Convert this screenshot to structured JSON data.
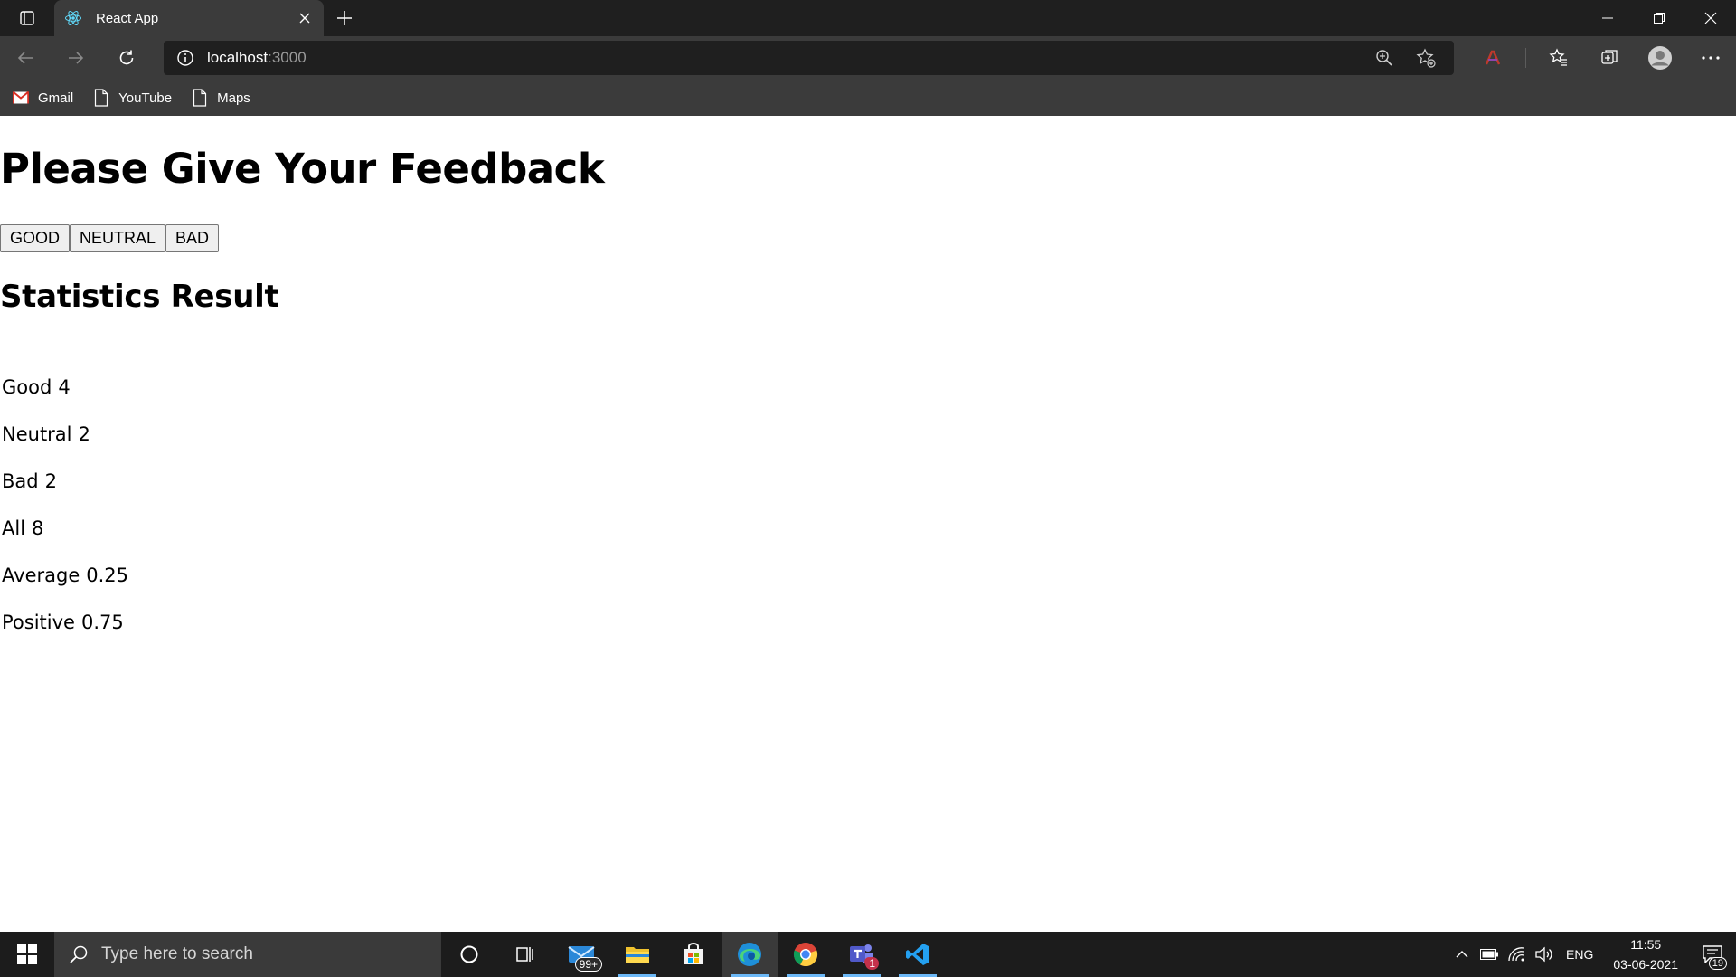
{
  "browser": {
    "tab_title": "React App",
    "url_host": "localhost",
    "url_port": ":3000",
    "bookmarks": [
      {
        "label": "Gmail",
        "icon": "gmail-icon"
      },
      {
        "label": "YouTube",
        "icon": "page-icon"
      },
      {
        "label": "Maps",
        "icon": "page-icon"
      }
    ]
  },
  "page": {
    "heading": "Please Give Your Feedback",
    "buttons": {
      "good": "GOOD",
      "neutral": "NEUTRAL",
      "bad": "BAD"
    },
    "stats_heading": "Statistics Result",
    "stats": [
      {
        "label": "Good",
        "value": "4"
      },
      {
        "label": "Neutral",
        "value": "2"
      },
      {
        "label": "Bad",
        "value": "2"
      },
      {
        "label": "All",
        "value": "8"
      },
      {
        "label": "Average",
        "value": "0.25"
      },
      {
        "label": "Positive",
        "value": "0.75"
      }
    ]
  },
  "taskbar": {
    "search_placeholder": "Type here to search",
    "mail_badge": "99+",
    "teams_badge": "1",
    "language": "ENG",
    "time": "11:55",
    "date": "03-06-2021",
    "notification_count": "19"
  },
  "colors": {
    "chrome_dark": "#1f1f1f",
    "chrome_mid": "#3b3b3b",
    "taskbar": "#1c1c1c",
    "accent": "#6cb8f6"
  }
}
